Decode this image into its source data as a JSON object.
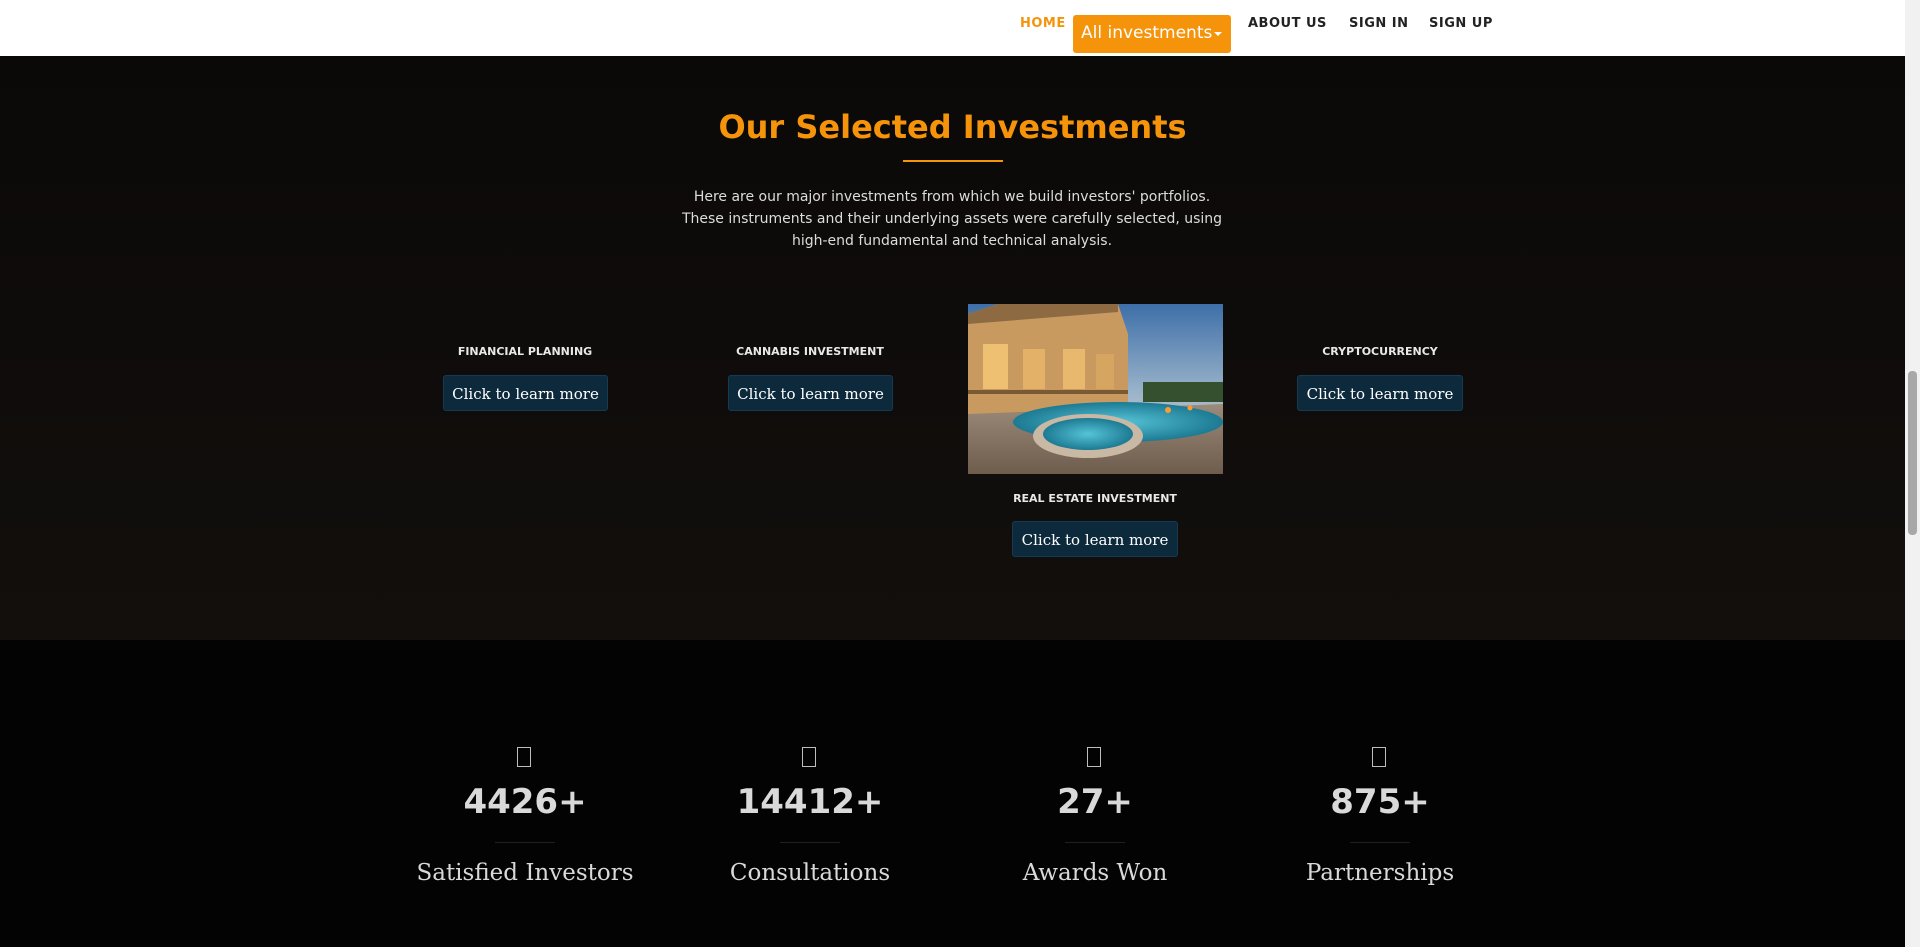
{
  "nav": {
    "home": "HOME",
    "dropdown": "All investments",
    "about": "ABOUT US",
    "signin": "SIGN IN",
    "signup": "SIGN UP"
  },
  "section": {
    "title": "Our Selected Investments",
    "description": "Here are our major investments from which we build investors' portfolios. These instruments and their underlying assets were carefully selected, using high-end fundamental and technical analysis."
  },
  "investments": [
    {
      "label": "FINANCIAL PLANNING",
      "button": "Click to learn more"
    },
    {
      "label": "CANNABIS INVESTMENT",
      "button": "Click to learn more"
    },
    {
      "label": "REAL ESTATE INVESTMENT",
      "button": "Click to learn more"
    },
    {
      "label": "CRYPTOCURRENCY",
      "button": "Click to learn more"
    }
  ],
  "stats": [
    {
      "value": "4426+",
      "label": "Satisfied Investors"
    },
    {
      "value": "14412+",
      "label": "Consultations"
    },
    {
      "value": "27+",
      "label": "Awards Won"
    },
    {
      "value": "875+",
      "label": "Partnerships"
    }
  ],
  "colors": {
    "accent": "#f5940b",
    "button_bg": "#0d2a3d",
    "dark_bg": "#0b0908"
  }
}
